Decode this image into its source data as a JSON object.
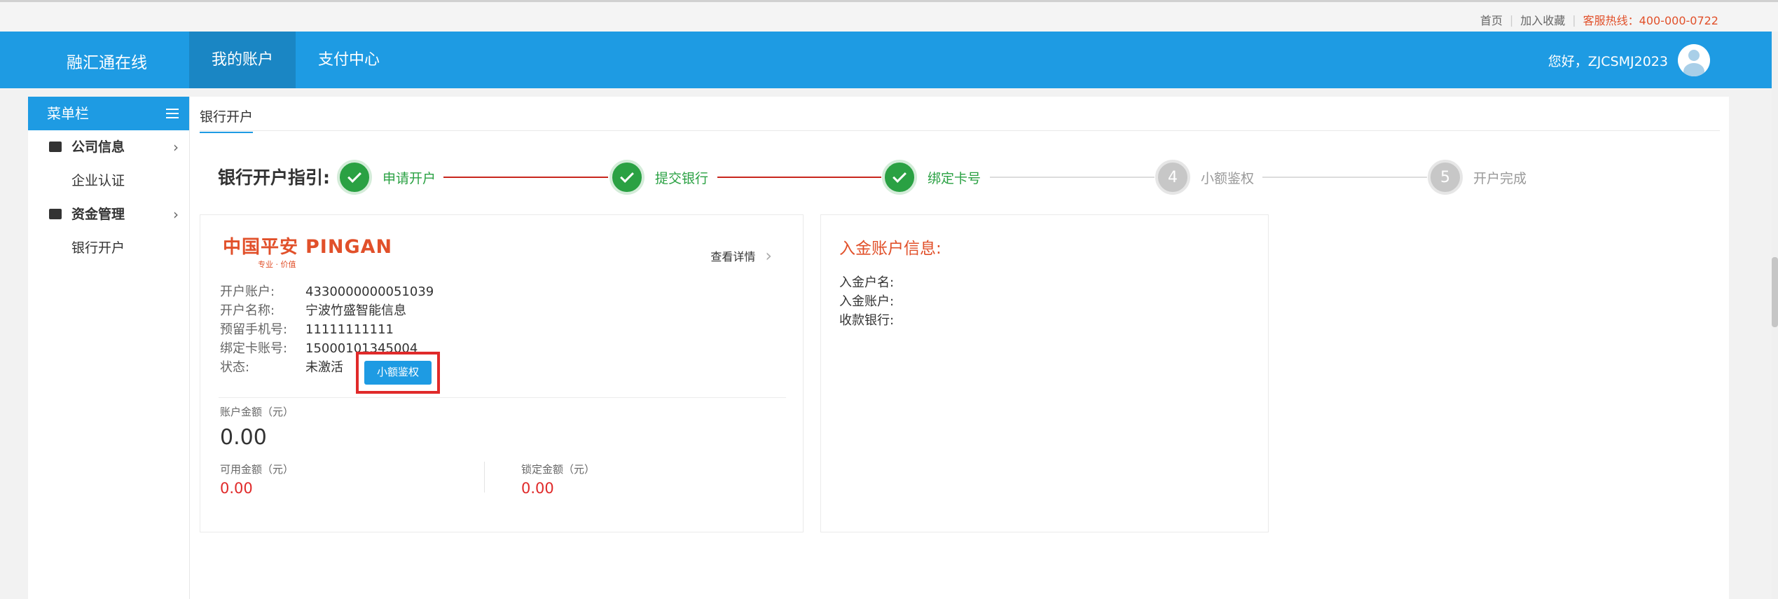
{
  "top_links": {
    "home": "首页",
    "favorite": "加入收藏",
    "hotline": "客服热线：400-000-0722"
  },
  "header": {
    "brand": "融汇通在线",
    "nav": [
      "我的账户",
      "支付中心"
    ],
    "greeting": "您好，ZJCSMJ2023"
  },
  "sidebar": {
    "title": "菜单栏",
    "groups": [
      {
        "label": "公司信息",
        "items": [
          "企业认证"
        ]
      },
      {
        "label": "资金管理",
        "items": [
          "银行开户"
        ]
      }
    ]
  },
  "main": {
    "tab": "银行开户",
    "guide_title": "银行开户指引:",
    "steps": [
      {
        "label": "申请开户",
        "status": "done"
      },
      {
        "label": "提交银行",
        "status": "done"
      },
      {
        "label": "绑定卡号",
        "status": "done"
      },
      {
        "label": "小额鉴权",
        "status": "todo",
        "number": "4"
      },
      {
        "label": "开户完成",
        "status": "todo",
        "number": "5"
      }
    ]
  },
  "bank_card": {
    "logo_cn": "中国平安",
    "logo_en": "PINGAN",
    "logo_sub": "专业 · 价值",
    "detail_link": "查看详情",
    "rows": [
      {
        "key": "开户账户:",
        "value": "4330000000051039"
      },
      {
        "key": "开户名称:",
        "value": "宁波竹盛智能信息"
      },
      {
        "key": "预留手机号:",
        "value": "11111111111"
      },
      {
        "key": "绑定卡账号:",
        "value": "15000101345004"
      },
      {
        "key": "状态:",
        "value": "未激活"
      }
    ],
    "auth_button": "小额鉴权",
    "balance_label": "账户金额（元）",
    "balance": "0.00",
    "available_label": "可用金额（元）",
    "available": "0.00",
    "locked_label": "锁定金额（元）",
    "locked": "0.00"
  },
  "deposit": {
    "title": "入金账户信息:",
    "rows": [
      "入金户名:",
      "入金账户:",
      "收款银行:"
    ]
  },
  "colors": {
    "primary": "#1e9be3",
    "success": "#2aa143",
    "accent": "#e1502a",
    "danger": "#e02a2a"
  }
}
